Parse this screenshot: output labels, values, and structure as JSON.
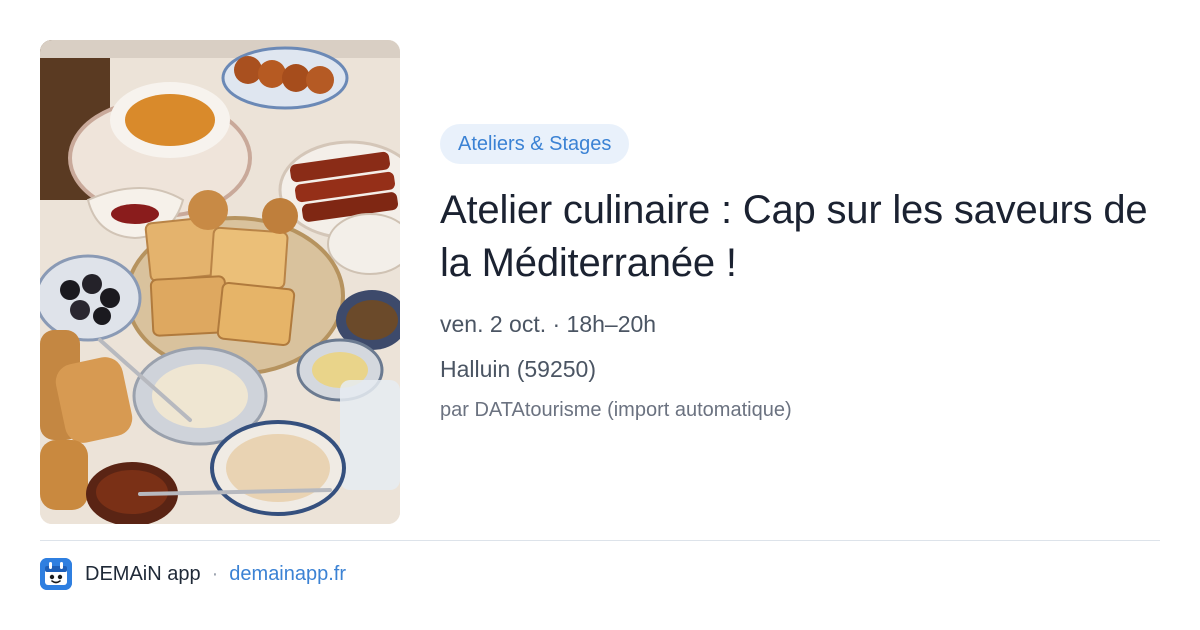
{
  "event": {
    "category": "Ateliers & Stages",
    "title": "Atelier culinaire : Cap sur les saveurs de la Méditerranée !",
    "datetime": "ven. 2 oct. · 18h–20h",
    "location": "Halluin (59250)",
    "source": "par DATAtourisme (import automatique)"
  },
  "footer": {
    "app_name": "DEMAiN app",
    "separator": "·",
    "link": "demainapp.fr"
  },
  "colors": {
    "accent": "#3b82d4",
    "badge_bg": "#e9f1fb"
  },
  "icons": {
    "app_logo": "demain-app-logo-icon",
    "photo": "mediterranean-food-photo"
  }
}
